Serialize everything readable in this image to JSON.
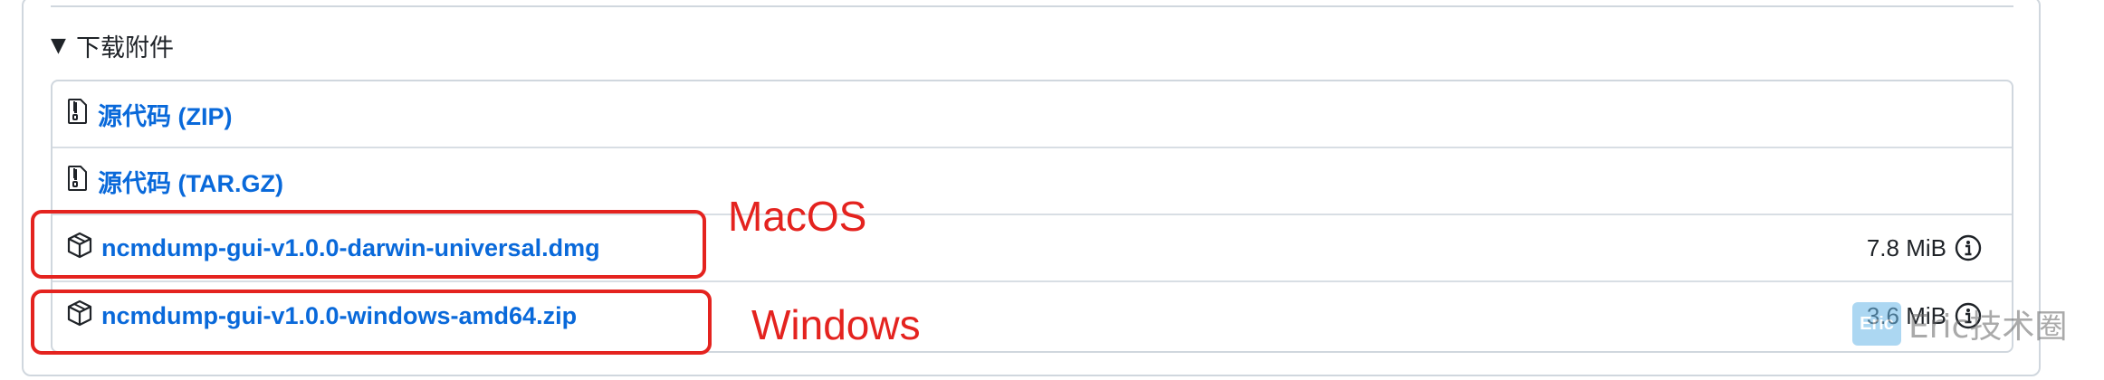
{
  "details": {
    "toggle_symbol": "▼",
    "title": "下载附件"
  },
  "assets": [
    {
      "icon": "file-zip-icon",
      "name": "源代码 (ZIP)",
      "size": ""
    },
    {
      "icon": "file-zip-icon",
      "name": "源代码 (TAR.GZ)",
      "size": ""
    },
    {
      "icon": "package-icon",
      "name": "ncmdump-gui-v1.0.0-darwin-universal.dmg",
      "size": "7.8 MiB"
    },
    {
      "icon": "package-icon",
      "name": "ncmdump-gui-v1.0.0-windows-amd64.zip",
      "size": "3.6 MiB"
    }
  ],
  "annotations": {
    "macos": "MacOS",
    "windows": "Windows",
    "color": "#e4231f"
  },
  "watermark": {
    "logo_text": "Eric",
    "text": "Eric技术圈"
  },
  "colors": {
    "link": "#0969da",
    "border": "#d0d7de"
  }
}
